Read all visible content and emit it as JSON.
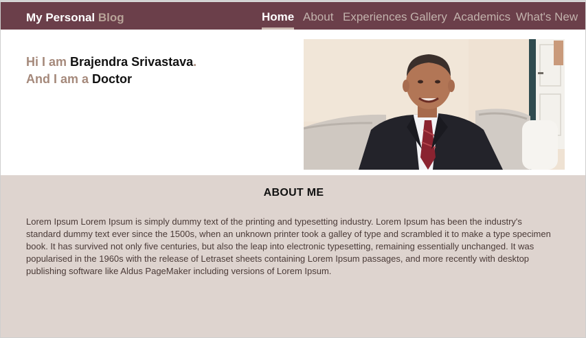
{
  "brand": {
    "prefix": "My Personal",
    "accent": "Blog"
  },
  "nav": {
    "items": [
      {
        "label": "Home",
        "active": true
      },
      {
        "label": "About"
      },
      {
        "label": "Experiences"
      },
      {
        "label": "Gallery"
      },
      {
        "label": "Academics"
      },
      {
        "label": "What's New"
      }
    ]
  },
  "hero": {
    "line1_lead": "Hi I am",
    "name": "Brajendra Srivastava",
    "line1_end": ".",
    "line2_lead": "And I am a",
    "profession": "Doctor"
  },
  "about": {
    "heading": "ABOUT ME",
    "body": "Lorem Ipsum Lorem Ipsum is simply dummy text of the printing and typesetting industry. Lorem Ipsum has been the industry's standard dummy text ever since the 1500s, when an unknown printer took a galley of type and scrambled it to make a type specimen book. It has survived not only five centuries, but also the leap into electronic typesetting, remaining essentially unchanged. It was popularised in the 1960s with the release of Letraset sheets containing Lorem Ipsum passages, and more recently with desktop publishing software like Aldus PageMaker including versions of Lorem Ipsum."
  },
  "colors": {
    "navbar": "#6b3f4a",
    "nav_inactive": "#c2b2ac",
    "accent_text": "#a5897b",
    "about_bg": "#ded4cf"
  }
}
